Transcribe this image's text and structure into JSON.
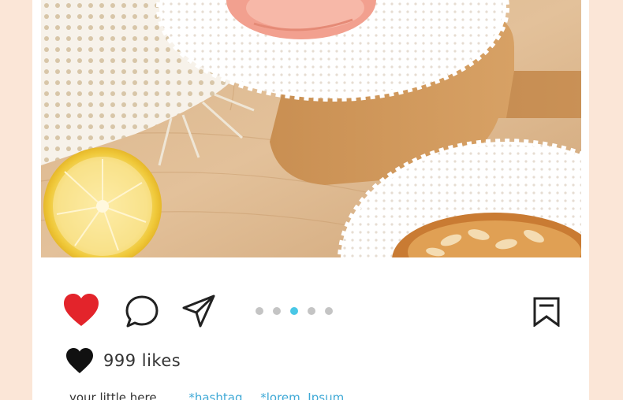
{
  "post": {
    "image_icon": "food-photo",
    "actions": {
      "like_icon": "heart-filled-icon",
      "like_color": "#e3242b",
      "comment_icon": "speech-bubble-icon",
      "share_icon": "paper-plane-icon",
      "save_icon": "bookmark-icon"
    },
    "carousel": {
      "count": 5,
      "active_index": 2,
      "active_color": "#49c7e6",
      "inactive_color": "#c4c4c4"
    },
    "likes": {
      "icon": "heart-filled-icon",
      "text": "999 likes"
    },
    "caption": {
      "text": "your little here",
      "tags": [
        "*hashtag",
        "*lorem  Ipsum"
      ],
      "tag_color": "#3fa9d6"
    }
  },
  "colors": {
    "page_background": "#fbe6d7",
    "card_background": "#ffffff"
  }
}
